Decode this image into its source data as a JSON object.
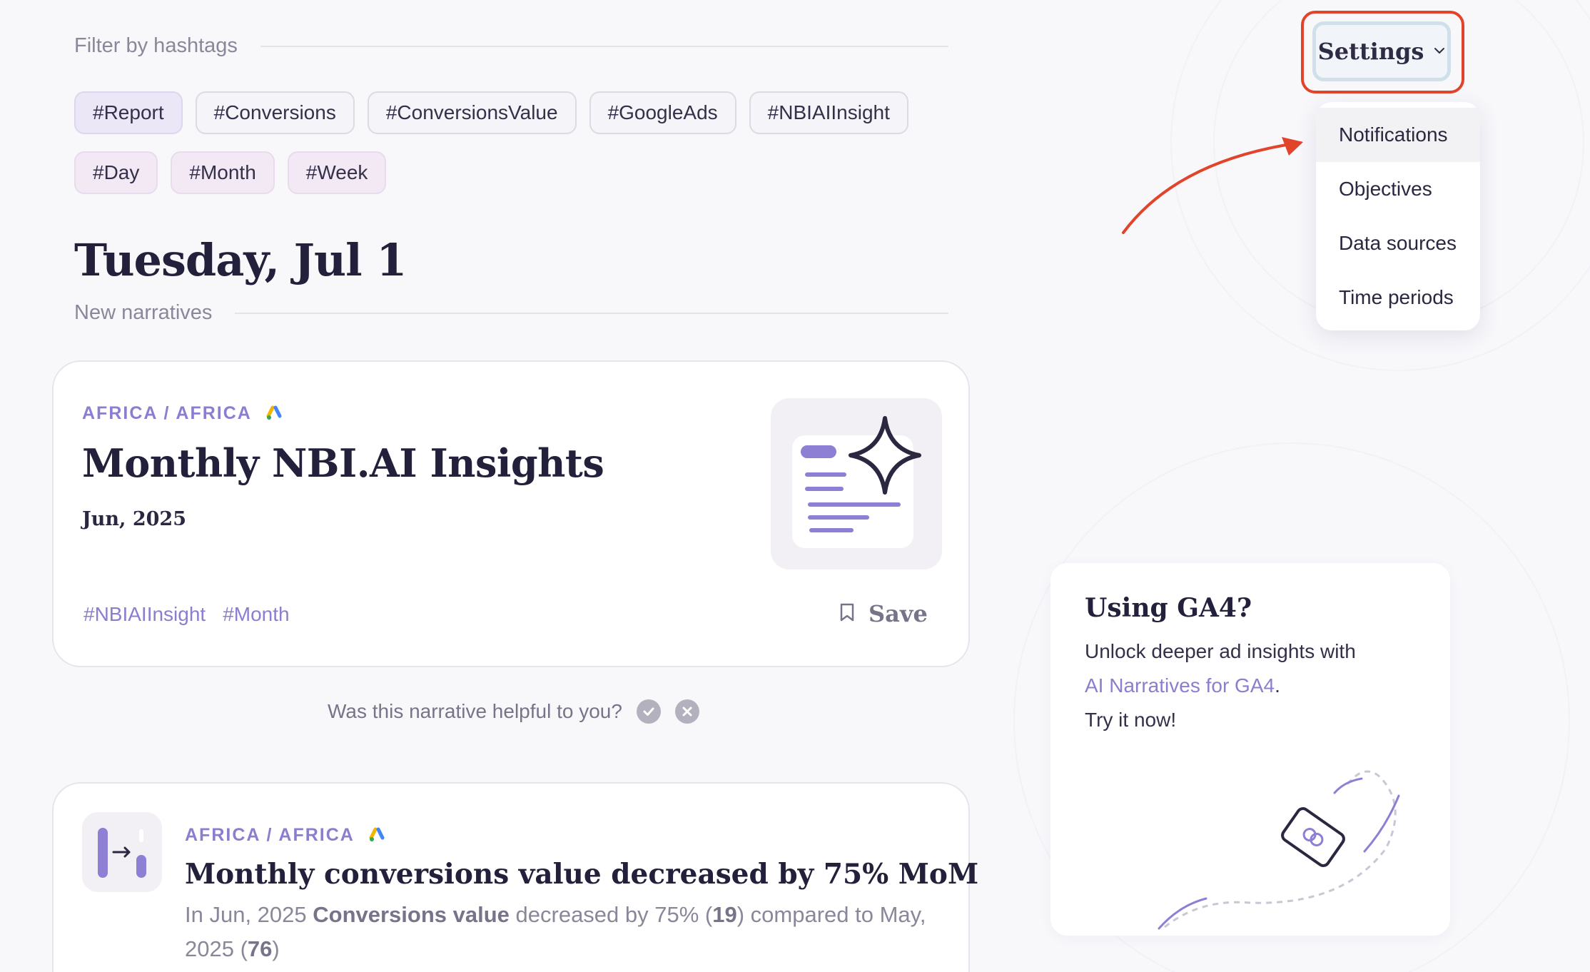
{
  "filter": {
    "label": "Filter by hashtags"
  },
  "tags": [
    {
      "label": "#Report",
      "kind": "active"
    },
    {
      "label": "#Conversions",
      "kind": "plain"
    },
    {
      "label": "#ConversionsValue",
      "kind": "plain"
    },
    {
      "label": "#GoogleAds",
      "kind": "plain"
    },
    {
      "label": "#NBIAIInsight",
      "kind": "plain"
    },
    {
      "label": "#Day",
      "kind": "time"
    },
    {
      "label": "#Month",
      "kind": "time"
    },
    {
      "label": "#Week",
      "kind": "time"
    }
  ],
  "date_heading": "Tuesday, Jul 1",
  "section_label": "New narratives",
  "card1": {
    "region": "AFRICA / AFRICA",
    "title": "Monthly NBI.AI Insights",
    "period": "Jun, 2025",
    "hashtags": [
      "#NBIAIInsight",
      "#Month"
    ],
    "save_label": "Save"
  },
  "feedback": {
    "question": "Was this narrative helpful to you?"
  },
  "card2": {
    "region": "AFRICA / AFRICA",
    "title": "Monthly conversions value decreased by 75% MoM",
    "desc_prefix": "In Jun, 2025 ",
    "desc_metric": "Conversions value",
    "desc_mid": " decreased by 75% (",
    "desc_value1": "19",
    "desc_mid2": ") compared to May, 2025 (",
    "desc_value2": "76",
    "desc_suffix": ")"
  },
  "settings": {
    "label": "Settings",
    "menu": [
      "Notifications",
      "Objectives",
      "Data sources",
      "Time periods"
    ]
  },
  "promo": {
    "title": "Using GA4?",
    "line1": "Unlock deeper ad insights with",
    "link": "AI Narratives for GA4",
    "link_suffix": ".",
    "line3": "Try it now!"
  },
  "colors": {
    "accent": "#8b7dd0",
    "highlight_outline": "#e2432b",
    "annotation_arrow": "#e2432b"
  }
}
